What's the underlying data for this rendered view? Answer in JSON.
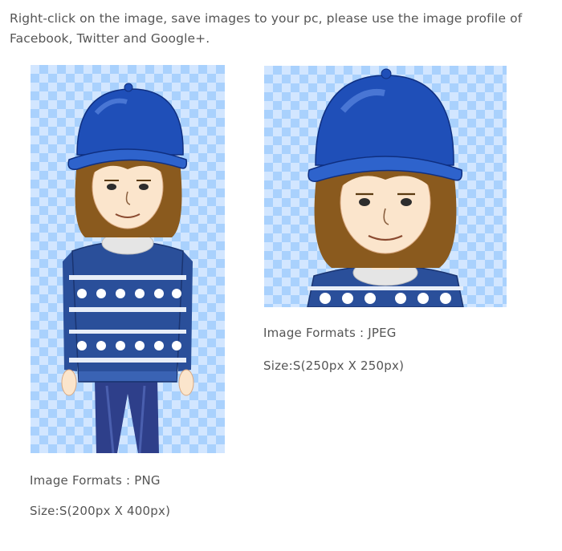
{
  "intro": {
    "text": "Right-click on the image, save images to your pc, please use the image profile of Facebook, Twitter and Google+."
  },
  "images": [
    {
      "id": "png",
      "format_label": "Image Formats : PNG",
      "size_label": "Size:S(200px X 400px)",
      "icon": "avatar-full-body"
    },
    {
      "id": "jpeg",
      "format_label": "Image Formats : JPEG",
      "size_label": "Size:S(250px X 250px)",
      "icon": "avatar-bust"
    }
  ],
  "colors": {
    "text": "#555555",
    "checker_light": "#d2e6ff",
    "checker_dark": "#a9d1fd",
    "cap": "#1f4fb8",
    "hair": "#8a5a1e",
    "sweater": "#2a4f9a",
    "jeans": "#2e3f8a"
  }
}
